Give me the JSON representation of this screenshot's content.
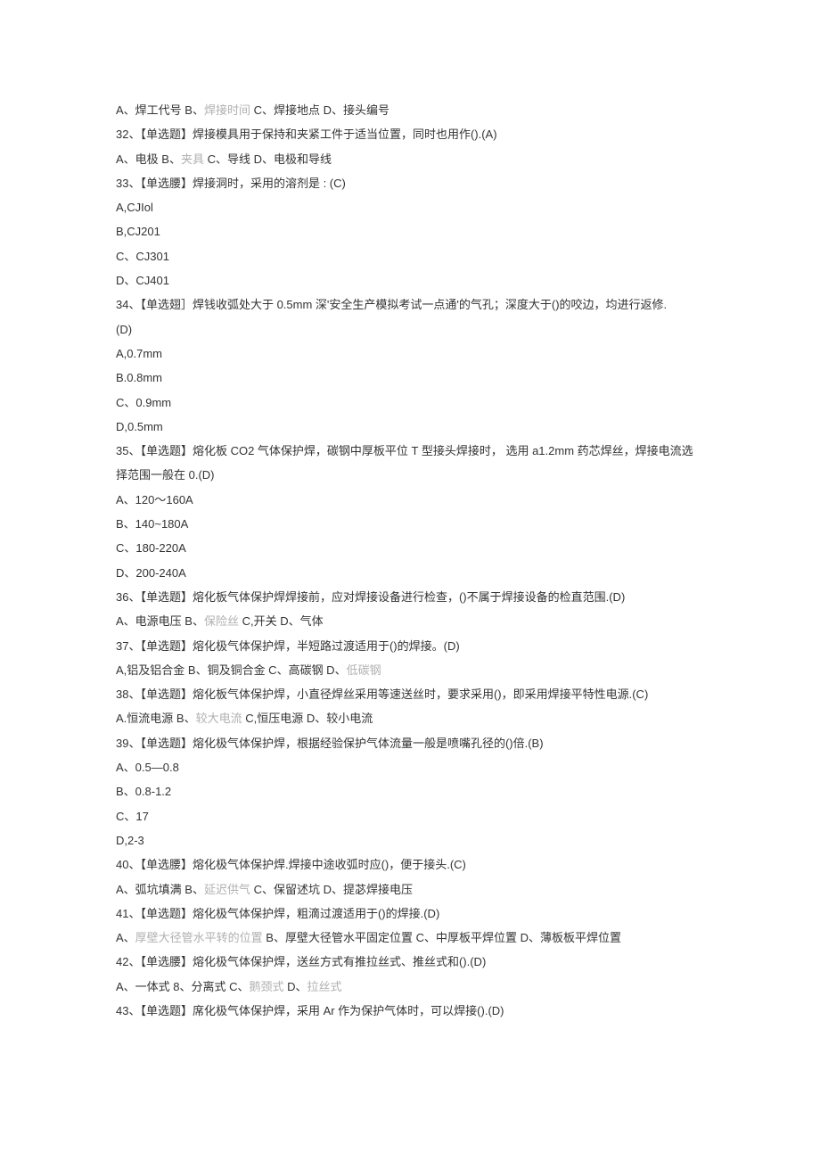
{
  "lines": [
    {
      "segments": [
        {
          "t": "A、焊工代号 B、"
        },
        {
          "t": "焊接时间",
          "faded": true
        },
        {
          "t": " C、焊接地点 D、接头编号"
        }
      ]
    },
    {
      "segments": [
        {
          "t": "32、【单选题】焊接模具用于保持和夹紧工件于适当位置，同时也用作().(A)"
        }
      ]
    },
    {
      "segments": [
        {
          "t": "A、电极 B、"
        },
        {
          "t": "夹具",
          "faded": true
        },
        {
          "t": " C、导线 D、电极和导线"
        }
      ]
    },
    {
      "segments": [
        {
          "t": "33、【单选腰】焊接洞时，采用的溶剂是 : (C)"
        }
      ]
    },
    {
      "segments": [
        {
          "t": "A,CJIol"
        }
      ]
    },
    {
      "segments": [
        {
          "t": "B,CJ201"
        }
      ]
    },
    {
      "segments": [
        {
          "t": "C、CJ301"
        }
      ]
    },
    {
      "segments": [
        {
          "t": "D、CJ401"
        }
      ]
    },
    {
      "segments": [
        {
          "t": "34、【单选翅］焊钱收弧处大于 0.5mm 深'安全生产模拟考试一点通'的气孔；深度大于()的咬边，均进行返修."
        }
      ]
    },
    {
      "segments": [
        {
          "t": "(D)"
        }
      ]
    },
    {
      "segments": [
        {
          "t": "A,0.7mm"
        }
      ]
    },
    {
      "segments": [
        {
          "t": "B.0.8mm"
        }
      ]
    },
    {
      "segments": [
        {
          "t": "C、0.9mm"
        }
      ]
    },
    {
      "segments": [
        {
          "t": "D,0.5mm"
        }
      ]
    },
    {
      "segments": [
        {
          "t": "35、【单选题】熔化板 CO2 气体保护焊，碳钢中厚板平位 T 型接头焊接时， 选用 a1.2mm 药芯焊丝，焊接电流选"
        }
      ]
    },
    {
      "segments": [
        {
          "t": "择范围一般在 0.(D)"
        }
      ]
    },
    {
      "segments": [
        {
          "t": "A、120～160A"
        }
      ]
    },
    {
      "segments": [
        {
          "t": "B、140~180A"
        }
      ]
    },
    {
      "segments": [
        {
          "t": "C、180-220A"
        }
      ]
    },
    {
      "segments": [
        {
          "t": "D、200-240A"
        }
      ]
    },
    {
      "segments": [
        {
          "t": "36、【单选题】熔化板气体保护焊焊接前，应对焊接设备进行检查，()不属于焊接设备的检直范围.(D)"
        }
      ]
    },
    {
      "segments": [
        {
          "t": "A、电源电压 B、"
        },
        {
          "t": "保险丝",
          "faded": true
        },
        {
          "t": " C,开关 D、气体"
        }
      ]
    },
    {
      "segments": [
        {
          "t": "37、【单选题】熔化极气体保护焊，半短路过渡适用于()的焊接。(D)"
        }
      ]
    },
    {
      "segments": [
        {
          "t": "A,铝及铝合金 B、铜及铜合金 C、高碳钢 D、"
        },
        {
          "t": "低碳钢",
          "faded": true
        }
      ]
    },
    {
      "segments": [
        {
          "t": "38、【单选题】熔化板气体保护焊，小直径焊丝采用等速送丝时，要求采用()，即采用焊接平特性电源.(C)"
        }
      ]
    },
    {
      "segments": [
        {
          "t": "A.恒流电源 B、"
        },
        {
          "t": "较大电流",
          "faded": true
        },
        {
          "t": " C,恒压电源 D、较小电流"
        }
      ]
    },
    {
      "segments": [
        {
          "t": "39、【单选题】熔化极气体保护焊，根据经验保护气体流量一般是喷嘴孔径的()倍.(B)"
        }
      ]
    },
    {
      "segments": [
        {
          "t": "A、0.5—0.8"
        }
      ]
    },
    {
      "segments": [
        {
          "t": "B、0.8-1.2"
        }
      ]
    },
    {
      "segments": [
        {
          "t": "C、17"
        }
      ]
    },
    {
      "segments": [
        {
          "t": "D,2-3"
        }
      ]
    },
    {
      "segments": [
        {
          "t": "40、【单选腰】熔化极气体保护焊.焊接中途收弧时应()，便于接头.(C)"
        }
      ]
    },
    {
      "segments": [
        {
          "t": "A、弧坑填满 B、"
        },
        {
          "t": "延迟供气",
          "faded": true
        },
        {
          "t": " C、保留述坑 D、提苾焊接电压"
        }
      ]
    },
    {
      "segments": [
        {
          "t": "41、【单选题】熔化极气体保护焊，粗滴过渡适用于()的焊接.(D)"
        }
      ]
    },
    {
      "segments": [
        {
          "t": "A、"
        },
        {
          "t": "厚壁大径管水平转的位置",
          "faded": true
        },
        {
          "t": " B、厚壁大径管水平固定位置 C、中厚板平焊位置 D、薄板板平焊位置"
        }
      ]
    },
    {
      "segments": [
        {
          "t": "42、【单选腰】熔化极气体保护焊，送丝方式有推拉丝式、推丝式和().(D)"
        }
      ]
    },
    {
      "segments": [
        {
          "t": "A、一体式 8、分离式 C、"
        },
        {
          "t": "鹅颈式",
          "faded": true
        },
        {
          "t": " D、"
        },
        {
          "t": "拉丝式",
          "faded": true
        }
      ]
    },
    {
      "segments": [
        {
          "t": "43、【单选题】席化极气体保护焊，采用 Ar 作为保护气体时，可以焊接().(D)"
        }
      ]
    }
  ]
}
